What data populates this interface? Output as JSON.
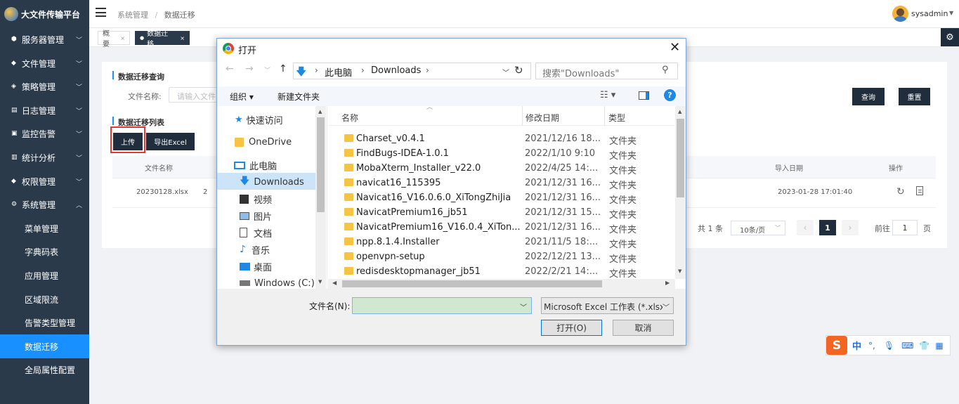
{
  "app": {
    "title": "大文件传输平台"
  },
  "header": {
    "breadcrumb": [
      "系统管理",
      "数据迁移"
    ],
    "user": "sysadmin"
  },
  "sidebar": {
    "items": [
      {
        "label": "服务器管理",
        "icon": "server-icon"
      },
      {
        "label": "文件管理",
        "icon": "folder-icon"
      },
      {
        "label": "策略管理",
        "icon": "policy-icon"
      },
      {
        "label": "日志管理",
        "icon": "log-icon"
      },
      {
        "label": "监控告警",
        "icon": "monitor-icon"
      },
      {
        "label": "统计分析",
        "icon": "chart-icon"
      },
      {
        "label": "权限管理",
        "icon": "permission-icon"
      },
      {
        "label": "系统管理",
        "icon": "settings-icon"
      }
    ],
    "sub_items": [
      "菜单管理",
      "字典码表",
      "应用管理",
      "区域限流",
      "告警类型管理",
      "数据迁移",
      "全局属性配置"
    ]
  },
  "tabs": [
    {
      "label": "概要"
    },
    {
      "label": "数据迁移"
    }
  ],
  "query": {
    "section_title": "数据迁移查询",
    "filename_label": "文件名称:",
    "filename_placeholder": "请输入文件",
    "query_button": "查询",
    "reset_button": "重置"
  },
  "list": {
    "section_title": "数据迁移列表",
    "upload_button": "上传",
    "export_button": "导出Excel",
    "columns": [
      "文件名称",
      "导入日期",
      "操作"
    ],
    "rows": [
      {
        "filename": "20230128.xlsx",
        "col2_partial": "2",
        "import_date": "2023-01-28 17:01:40"
      }
    ]
  },
  "pagination": {
    "total": "共 1 条",
    "page_size": "10条/页",
    "current_page": "1",
    "goto_prefix": "前往",
    "goto_value": "1",
    "goto_suffix": "页"
  },
  "dialog": {
    "title": "打开",
    "nav_path": [
      "此电脑",
      "Downloads"
    ],
    "search_placeholder": "搜索\"Downloads\"",
    "toolbar": {
      "organize": "组织",
      "new_folder": "新建文件夹"
    },
    "nav_pane": [
      {
        "label": "快速访问",
        "icon": "star-icon"
      },
      {
        "label": "OneDrive",
        "icon": "folder-icon"
      },
      {
        "label": "此电脑",
        "icon": "computer-icon"
      },
      {
        "label": "Downloads",
        "icon": "download-arrow-icon"
      },
      {
        "label": "视频",
        "icon": "video-icon"
      },
      {
        "label": "图片",
        "icon": "picture-icon"
      },
      {
        "label": "文档",
        "icon": "document-icon"
      },
      {
        "label": "音乐",
        "icon": "music-icon"
      },
      {
        "label": "桌面",
        "icon": "desktop-icon"
      },
      {
        "label": "Windows (C:)",
        "icon": "drive-icon"
      }
    ],
    "columns": [
      "名称",
      "修改日期",
      "类型"
    ],
    "files": [
      {
        "name": "Charset_v0.4.1",
        "date": "2021/12/16 18...",
        "type": "文件夹"
      },
      {
        "name": "FindBugs-IDEA-1.0.1",
        "date": "2022/1/10 9:10",
        "type": "文件夹"
      },
      {
        "name": "MobaXterm_Installer_v22.0",
        "date": "2022/4/25 14:...",
        "type": "文件夹"
      },
      {
        "name": "navicat16_115395",
        "date": "2021/12/31 16...",
        "type": "文件夹"
      },
      {
        "name": "Navicat16_V16.0.6.0_XiTongZhiJia",
        "date": "2021/12/31 16...",
        "type": "文件夹"
      },
      {
        "name": "NavicatPremium16_jb51",
        "date": "2021/12/31 15...",
        "type": "文件夹"
      },
      {
        "name": "NavicatPremium16_V16.0.4_XiTon...",
        "date": "2021/12/31 16...",
        "type": "文件夹"
      },
      {
        "name": "npp.8.1.4.Installer",
        "date": "2021/11/5 18:...",
        "type": "文件夹"
      },
      {
        "name": "openvpn-setup",
        "date": "2022/12/21 13...",
        "type": "文件夹"
      },
      {
        "name": "redisdesktopmanager_jb51",
        "date": "2022/2/21 14:...",
        "type": "文件夹"
      }
    ],
    "filename_label": "文件名(N):",
    "filename_value": "",
    "filetype": "Microsoft Excel 工作表 (*.xlsx",
    "open_button": "打开(O)",
    "cancel_button": "取消"
  },
  "ime": {
    "label": "中"
  }
}
